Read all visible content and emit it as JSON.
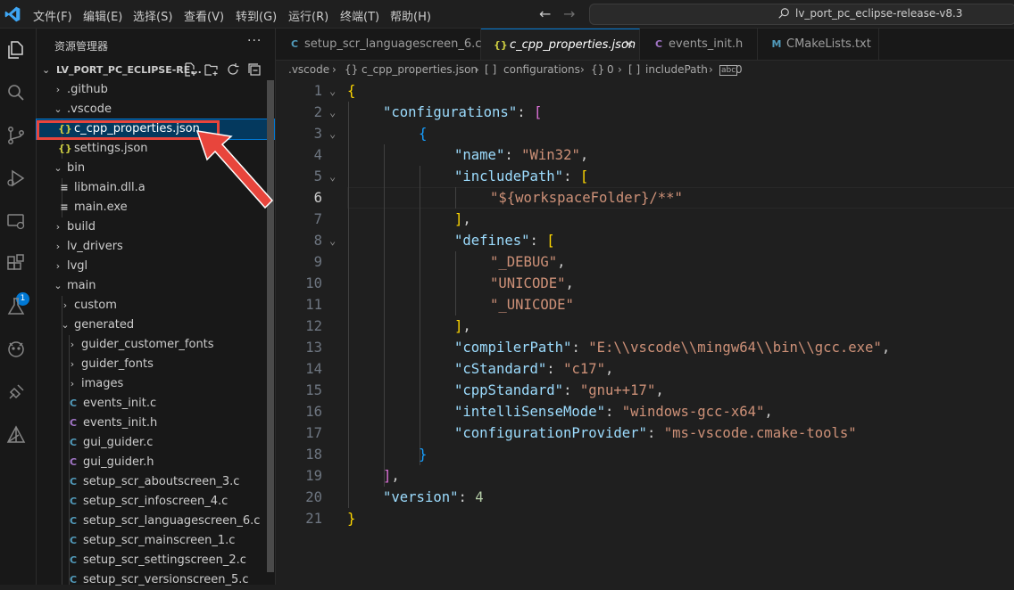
{
  "menu": [
    "文件(F)",
    "编辑(E)",
    "选择(S)",
    "查看(V)",
    "转到(G)",
    "运行(R)",
    "终端(T)",
    "帮助(H)"
  ],
  "search": {
    "text": "lv_port_pc_eclipse-release-v8.3"
  },
  "activity_badge": "1",
  "sidebar": {
    "title": "资源管理器",
    "more": "···",
    "project": "LV_PORT_PC_ECLIPSE-RE...",
    "tree": [
      {
        "label": ".github",
        "icon": "",
        "chev": "›"
      },
      {
        "label": ".vscode",
        "icon": "",
        "chev": "⌄"
      },
      {
        "label": "c_cpp_properties.json",
        "icon": "{}",
        "chev": ""
      },
      {
        "label": "settings.json",
        "icon": "{}",
        "chev": ""
      },
      {
        "label": "bin",
        "icon": "",
        "chev": "⌄"
      },
      {
        "label": "libmain.dll.a",
        "icon": "≡",
        "chev": ""
      },
      {
        "label": "main.exe",
        "icon": "≡",
        "chev": ""
      },
      {
        "label": "build",
        "icon": "",
        "chev": "›"
      },
      {
        "label": "lv_drivers",
        "icon": "",
        "chev": "›"
      },
      {
        "label": "lvgl",
        "icon": "",
        "chev": "›"
      },
      {
        "label": "main",
        "icon": "",
        "chev": "⌄"
      },
      {
        "label": "custom",
        "icon": "",
        "chev": "›"
      },
      {
        "label": "generated",
        "icon": "",
        "chev": "⌄"
      },
      {
        "label": "guider_customer_fonts",
        "icon": "",
        "chev": "›"
      },
      {
        "label": "guider_fonts",
        "icon": "",
        "chev": "›"
      },
      {
        "label": "images",
        "icon": "",
        "chev": "›"
      },
      {
        "label": "events_init.c",
        "icon": "C",
        "chev": ""
      },
      {
        "label": "events_init.h",
        "icon": "C",
        "chev": ""
      },
      {
        "label": "gui_guider.c",
        "icon": "C",
        "chev": ""
      },
      {
        "label": "gui_guider.h",
        "icon": "C",
        "chev": ""
      },
      {
        "label": "setup_scr_aboutscreen_3.c",
        "icon": "C",
        "chev": ""
      },
      {
        "label": "setup_scr_infoscreen_4.c",
        "icon": "C",
        "chev": ""
      },
      {
        "label": "setup_scr_languagescreen_6.c",
        "icon": "C",
        "chev": ""
      },
      {
        "label": "setup_scr_mainscreen_1.c",
        "icon": "C",
        "chev": ""
      },
      {
        "label": "setup_scr_settingscreen_2.c",
        "icon": "C",
        "chev": ""
      },
      {
        "label": "setup_scr_versionscreen_5.c",
        "icon": "C",
        "chev": ""
      }
    ]
  },
  "tabs": [
    {
      "label": "setup_scr_languagescreen_6.c",
      "icon": "C"
    },
    {
      "label": "c_cpp_properties.json",
      "icon": "{}",
      "close": "✕"
    },
    {
      "label": "events_init.h",
      "icon": "C"
    },
    {
      "label": "CMakeLists.txt",
      "icon": "M"
    }
  ],
  "breadcrumb": [
    ".vscode",
    "›",
    "{}",
    "c_cpp_properties.json",
    "›",
    "[ ]",
    "configurations",
    "›",
    "{}",
    "0",
    "›",
    "[ ]",
    "includePath",
    "›",
    "0"
  ],
  "editor": {
    "line_numbers": [
      "1",
      "2",
      "3",
      "4",
      "5",
      "6",
      "7",
      "8",
      "9",
      "10",
      "11",
      "12",
      "13",
      "14",
      "15",
      "16",
      "17",
      "18",
      "19",
      "20",
      "21"
    ],
    "lines": {
      "l1": "{",
      "l2_key": "\"configurations\"",
      "l2_colon": ": ",
      "l2_br": "[",
      "l3": "{",
      "l4_key": "\"name\"",
      "l4_colon": ": ",
      "l4_val": "\"Win32\"",
      "l4_comma": ",",
      "l5_key": "\"includePath\"",
      "l5_colon": ": ",
      "l5_br": "[",
      "l6_val": "\"${workspaceFolder}/**\"",
      "l7_br": "]",
      "l7_comma": ",",
      "l8_key": "\"defines\"",
      "l8_colon": ": ",
      "l8_br": "[",
      "l9_val": "\"_DEBUG\"",
      "l9_comma": ",",
      "l10_val": "\"UNICODE\"",
      "l10_comma": ",",
      "l11_val": "\"_UNICODE\"",
      "l12_br": "]",
      "l12_comma": ",",
      "l13_key": "\"compilerPath\"",
      "l13_colon": ": ",
      "l13_val": "\"E:\\\\vscode\\\\mingw64\\\\bin\\\\gcc.exe\"",
      "l13_comma": ",",
      "l14_key": "\"cStandard\"",
      "l14_colon": ": ",
      "l14_val": "\"c17\"",
      "l14_comma": ",",
      "l15_key": "\"cppStandard\"",
      "l15_colon": ": ",
      "l15_val": "\"gnu++17\"",
      "l15_comma": ",",
      "l16_key": "\"intelliSenseMode\"",
      "l16_colon": ": ",
      "l16_val": "\"windows-gcc-x64\"",
      "l16_comma": ",",
      "l17_key": "\"configurationProvider\"",
      "l17_colon": ": ",
      "l17_val": "\"ms-vscode.cmake-tools\"",
      "l18": "}",
      "l19_br": "]",
      "l19_comma": ",",
      "l20_key": "\"version\"",
      "l20_colon": ": ",
      "l20_val": "4",
      "l21": "}"
    }
  },
  "colors": {
    "accent": "#0078d4",
    "highlight": "#e8453c"
  }
}
